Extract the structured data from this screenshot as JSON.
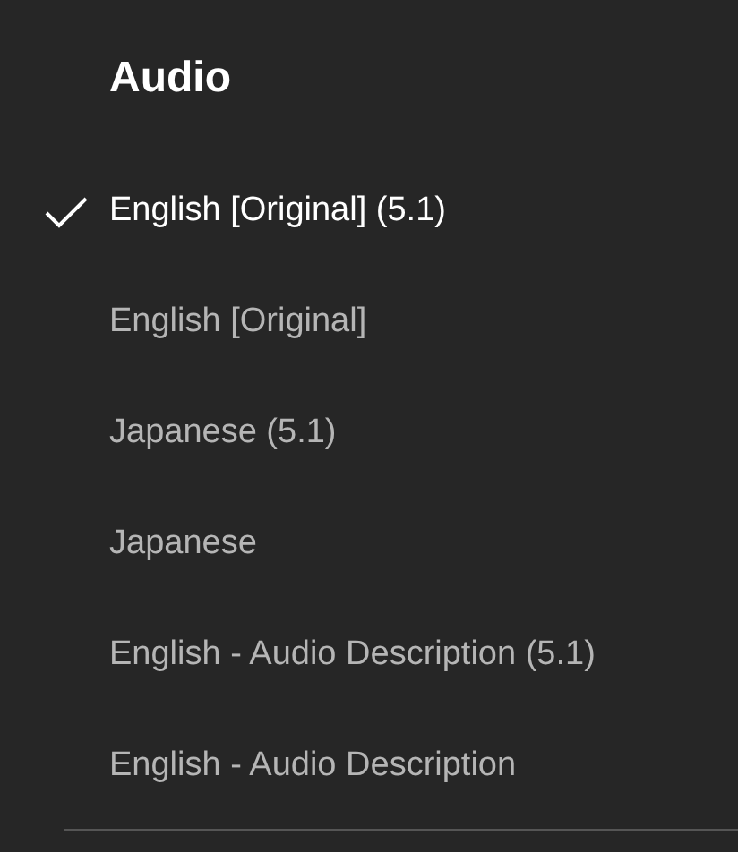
{
  "menu": {
    "title": "Audio",
    "items": [
      {
        "label": "English [Original] (5.1)",
        "selected": true
      },
      {
        "label": "English [Original]",
        "selected": false
      },
      {
        "label": "Japanese (5.1)",
        "selected": false
      },
      {
        "label": "Japanese",
        "selected": false
      },
      {
        "label": "English - Audio Description (5.1)",
        "selected": false
      },
      {
        "label": "English - Audio Description",
        "selected": false
      }
    ]
  }
}
